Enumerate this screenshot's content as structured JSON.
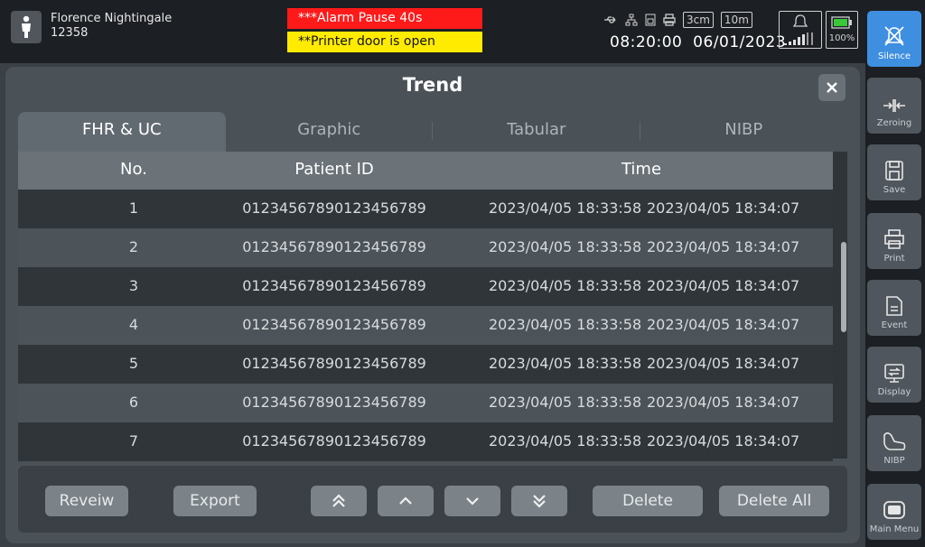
{
  "patient": {
    "name": "Florence Nightingale",
    "id": "12358"
  },
  "alarms": {
    "primary": "***Alarm Pause 40s",
    "secondary": "**Printer door is open"
  },
  "status": {
    "time": "08:20:00",
    "date": "06/01/2023",
    "speed": "3cm",
    "interval": "10m",
    "battery": "100%"
  },
  "colors": {
    "alarm_high": "#ff1a1a",
    "alarm_medium": "#ffeb00",
    "accent": "#3f8fe0"
  },
  "dialog": {
    "title": "Trend",
    "tabs": [
      "FHR & UC",
      "Graphic",
      "Tabular",
      "NIBP"
    ],
    "active_tab": "FHR & UC",
    "columns": [
      "No.",
      "Patient ID",
      "Time"
    ],
    "rows": [
      {
        "no": "1",
        "pid": "01234567890123456789",
        "start": "2023/04/05 18:33:58",
        "end": "2023/04/05 18:34:07"
      },
      {
        "no": "2",
        "pid": "01234567890123456789",
        "start": "2023/04/05 18:33:58",
        "end": "2023/04/05 18:34:07"
      },
      {
        "no": "3",
        "pid": "01234567890123456789",
        "start": "2023/04/05 18:33:58",
        "end": "2023/04/05 18:34:07"
      },
      {
        "no": "4",
        "pid": "01234567890123456789",
        "start": "2023/04/05 18:33:58",
        "end": "2023/04/05 18:34:07"
      },
      {
        "no": "5",
        "pid": "01234567890123456789",
        "start": "2023/04/05 18:33:58",
        "end": "2023/04/05 18:34:07"
      },
      {
        "no": "6",
        "pid": "01234567890123456789",
        "start": "2023/04/05 18:33:58",
        "end": "2023/04/05 18:34:07"
      },
      {
        "no": "7",
        "pid": "01234567890123456789",
        "start": "2023/04/05 18:33:58",
        "end": "2023/04/05 18:34:07"
      }
    ],
    "buttons": {
      "review": "Reveiw",
      "export": "Export",
      "delete": "Delete",
      "delete_all": "Delete All"
    }
  },
  "sidebar": [
    {
      "label": "Silence",
      "icon": "bell-off-icon",
      "active": true
    },
    {
      "label": "Zeroing",
      "icon": "zeroing-icon"
    },
    {
      "label": "Save",
      "icon": "floppy-icon"
    },
    {
      "label": "Print",
      "icon": "printer-icon"
    },
    {
      "label": "Event",
      "icon": "document-icon"
    },
    {
      "label": "Display",
      "icon": "monitor-icon"
    },
    {
      "label": "NIBP",
      "icon": "bp-cuff-icon"
    },
    {
      "label": "Main Menu",
      "icon": "menu-screen-icon"
    }
  ]
}
